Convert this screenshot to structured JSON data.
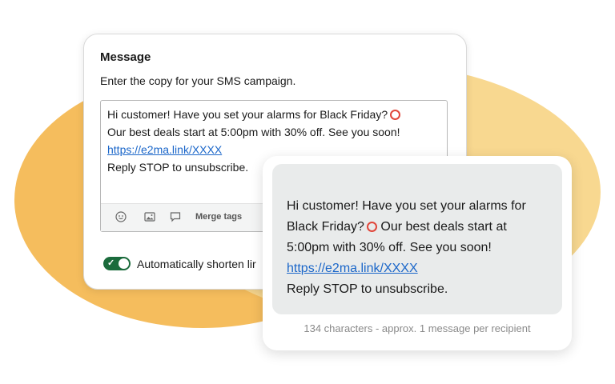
{
  "message_editor": {
    "title": "Message",
    "subtitle": "Enter the copy for your SMS campaign.",
    "textarea": {
      "line1": "Hi customer! Have you set your alarms for Black Friday?",
      "line2": "Our best deals start at 5:00pm with 30% off. See you soon!",
      "link": "https://e2ma.link/XXXX",
      "line4": "Reply STOP to unsubscribe."
    },
    "toolbar": {
      "merge_tags_label": "Merge tags",
      "icons": [
        "emoji-icon",
        "image-icon",
        "comment-icon"
      ]
    },
    "shorten_toggle": {
      "label": "Automatically shorten lir",
      "checked": true
    }
  },
  "preview": {
    "text_part1": "Hi customer! Have you set your alarms for Black Friday?",
    "text_part2": "Our best deals start at 5:00pm with 30% off. See you soon!",
    "link": "https://e2ma.link/XXXX",
    "text_part3": "Reply STOP to unsubscribe.",
    "character_count": "134 characters - approx. 1 message per recipient"
  },
  "colors": {
    "accent_green": "#1b6b3c",
    "link_blue": "#1a66c9",
    "alarm_red": "#e0463a",
    "blob_orange": "#f5bd5d",
    "blob_yellow": "#f8d890"
  }
}
